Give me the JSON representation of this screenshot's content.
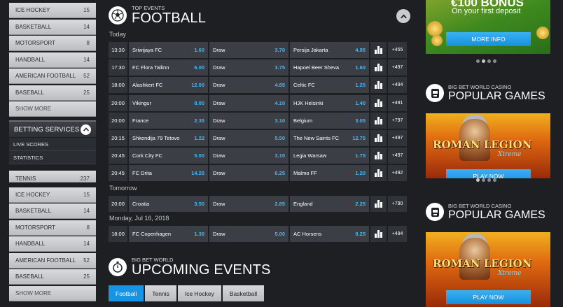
{
  "sidebar": {
    "top_sports": [
      {
        "label": "ICE HOCKEY",
        "count": "15"
      },
      {
        "label": "BASKETBALL",
        "count": "14"
      },
      {
        "label": "MOTORSPORT",
        "count": "8"
      },
      {
        "label": "HANDBALL",
        "count": "14"
      },
      {
        "label": "AMERICAN FOOTBALL",
        "count": "52"
      },
      {
        "label": "BASEBALL",
        "count": "25"
      }
    ],
    "show_more": "SHOW MORE",
    "betting_services": {
      "title": "BETTING SERVICES",
      "links": [
        "LIVE SCORES",
        "STATISTICS"
      ]
    },
    "bottom_sports": [
      {
        "label": "TENNIS",
        "count": "237"
      },
      {
        "label": "ICE HOCKEY",
        "count": "15"
      },
      {
        "label": "BASKETBALL",
        "count": "14"
      },
      {
        "label": "MOTORSPORT",
        "count": "8"
      },
      {
        "label": "HANDBALL",
        "count": "14"
      },
      {
        "label": "AMERICAN FOOTBALL",
        "count": "52"
      },
      {
        "label": "BASEBALL",
        "count": "25"
      }
    ],
    "show_more_2": "SHOW MORE"
  },
  "top_events": {
    "subtitle": "TOP EVENTS",
    "title": "FOOTBALL",
    "groups": [
      {
        "day": "Today",
        "matches": [
          {
            "time": "13:30",
            "home": "Sriwijaya FC",
            "home_odd": "1.60",
            "draw": "Draw",
            "draw_odd": "3.70",
            "away": "Persija Jakarta",
            "away_odd": "4.95",
            "more": "+455"
          },
          {
            "time": "17:30",
            "home": "FC Flora Tallinn",
            "home_odd": "6.00",
            "draw": "Draw",
            "draw_odd": "3.75",
            "away": "Hapoel Beer Sheva",
            "away_odd": "1.60",
            "more": "+497"
          },
          {
            "time": "18:00",
            "home": "Alashkert FC",
            "home_odd": "12.00",
            "draw": "Draw",
            "draw_odd": "4.85",
            "away": "Celtic FC",
            "away_odd": "1.25",
            "more": "+494"
          },
          {
            "time": "20:00",
            "home": "Vikingur",
            "home_odd": "8.00",
            "draw": "Draw",
            "draw_odd": "4.10",
            "away": "HJK Helsinki",
            "away_odd": "1.40",
            "more": "+491"
          },
          {
            "time": "20:00",
            "home": "France",
            "home_odd": "2.35",
            "draw": "Draw",
            "draw_odd": "3.10",
            "away": "Belgium",
            "away_odd": "3.05",
            "more": "+797"
          },
          {
            "time": "20:15",
            "home": "Shkendija 79 Tetovo",
            "home_odd": "1.22",
            "draw": "Draw",
            "draw_odd": "5.50",
            "away": "The New Saints FC",
            "away_odd": "12.75",
            "more": "+497"
          },
          {
            "time": "20:45",
            "home": "Cork City FC",
            "home_odd": "5.00",
            "draw": "Draw",
            "draw_odd": "3.15",
            "away": "Legia Warsaw",
            "away_odd": "1.75",
            "more": "+497"
          },
          {
            "time": "20:45",
            "home": "FC Drita",
            "home_odd": "14.25",
            "draw": "Draw",
            "draw_odd": "6.25",
            "away": "Malmo FF",
            "away_odd": "1.20",
            "more": "+492"
          }
        ]
      },
      {
        "day": "Tomorrow",
        "matches": [
          {
            "time": "20:00",
            "home": "Croatia",
            "home_odd": "3.50",
            "draw": "Draw",
            "draw_odd": "2.85",
            "away": "England",
            "away_odd": "2.25",
            "more": "+790"
          }
        ]
      },
      {
        "day": "Monday, Jul 16, 2018",
        "matches": [
          {
            "time": "18:00",
            "home": "FC Copenhagen",
            "home_odd": "1.30",
            "draw": "Draw",
            "draw_odd": "5.00",
            "away": "AC Horsens",
            "away_odd": "9.25",
            "more": "+494"
          }
        ]
      }
    ]
  },
  "upcoming": {
    "subtitle": "BIG BET WORLD",
    "title": "UPCOMING EVENTS",
    "tabs": [
      "Football",
      "Tennis",
      "Ice Hockey",
      "Basketball"
    ],
    "active_tab": 0
  },
  "right": {
    "promo": {
      "bonus": "€100 BONUS",
      "sub": "On your first deposit",
      "button": "MORE INFO",
      "dots": 4,
      "active_dot": 1
    },
    "casino_blocks": [
      {
        "subtitle": "BIG BET WORLD CASINO",
        "title": "POPULAR GAMES",
        "game_logo": "ROMAN LEGION",
        "game_logo_sub": "Xtreme",
        "button": "PLAY NOW"
      },
      {
        "subtitle": "BIG BET WORLD CASINO",
        "title": "POPULAR GAMES",
        "game_logo": "ROMAN LEGION",
        "game_logo_sub": "Xtreme",
        "button": "PLAY NOW"
      }
    ]
  },
  "colors": {
    "background": "#1d1f23",
    "cell": "#3b3e44",
    "odd_value": "#4ab3f4",
    "accent_blue": "#1794e6"
  }
}
